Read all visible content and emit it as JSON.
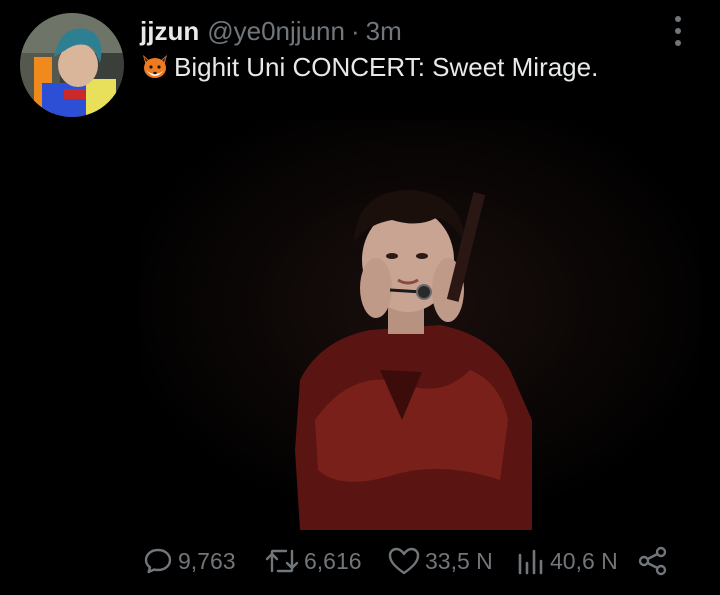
{
  "tweet": {
    "display_name": "jjzun",
    "handle": "@ye0njjunn",
    "separator": "·",
    "time": "3m",
    "text_emoji_icon": "fox-face-icon",
    "text": "Bighit Uni CONCERT: Sweet Mirage."
  },
  "media": {
    "icon": "concert-photo"
  },
  "actions": {
    "replies": "9,763",
    "retweets": "6,616",
    "likes": "33,5 N",
    "views": "40,6 N"
  },
  "colors": {
    "background": "#000000",
    "text": "#e7e9ea",
    "secondary": "#71767b"
  }
}
